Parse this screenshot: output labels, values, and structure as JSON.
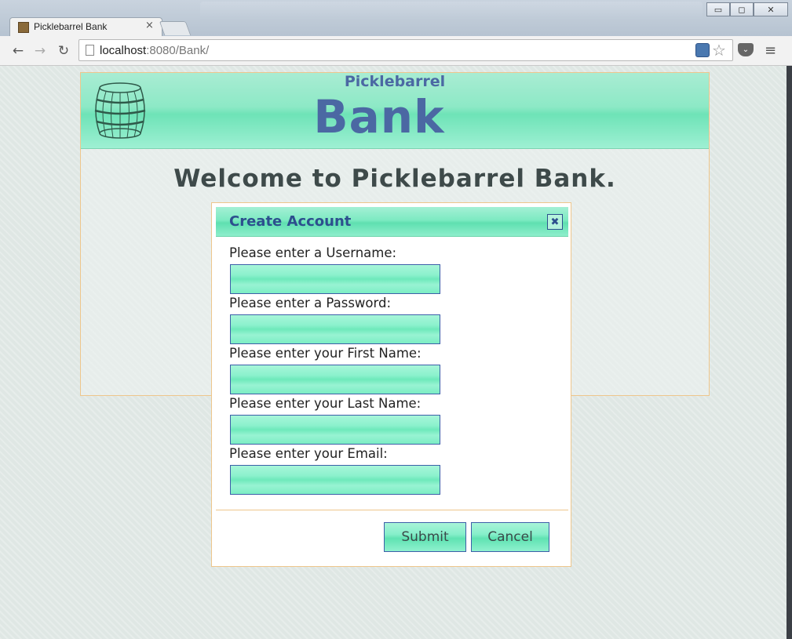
{
  "browser": {
    "tab_title": "Picklebarrel Bank",
    "tab_close": "×",
    "url_host": "localhost",
    "url_rest": ":8080/Bank/",
    "back_glyph": "←",
    "forward_glyph": "→",
    "reload_glyph": "↻",
    "star_glyph": "☆",
    "menu_glyph": "≡",
    "win_min": "▭",
    "win_max": "◻",
    "win_close": "✕"
  },
  "header": {
    "brand_small": "Picklebarrel",
    "brand_big": "Bank"
  },
  "main": {
    "welcome": "Welcome to Picklebarrel Bank."
  },
  "dialog": {
    "title": "Create Account",
    "close_glyph": "✖",
    "fields": [
      {
        "label": "Please enter a Username:",
        "value": ""
      },
      {
        "label": "Please enter a Password:",
        "value": ""
      },
      {
        "label": "Please enter your First Name:",
        "value": ""
      },
      {
        "label": "Please enter your Last Name:",
        "value": ""
      },
      {
        "label": "Please enter your Email:",
        "value": ""
      }
    ],
    "submit_label": "Submit",
    "cancel_label": "Cancel"
  },
  "colors": {
    "accent_green": "#7deac2",
    "brand_blue": "#4b68a3",
    "border_orange": "#eec68c"
  },
  "icons": [
    "barrel-logo-icon",
    "close-icon",
    "back-icon",
    "forward-icon",
    "reload-icon",
    "star-icon",
    "menu-icon"
  ]
}
